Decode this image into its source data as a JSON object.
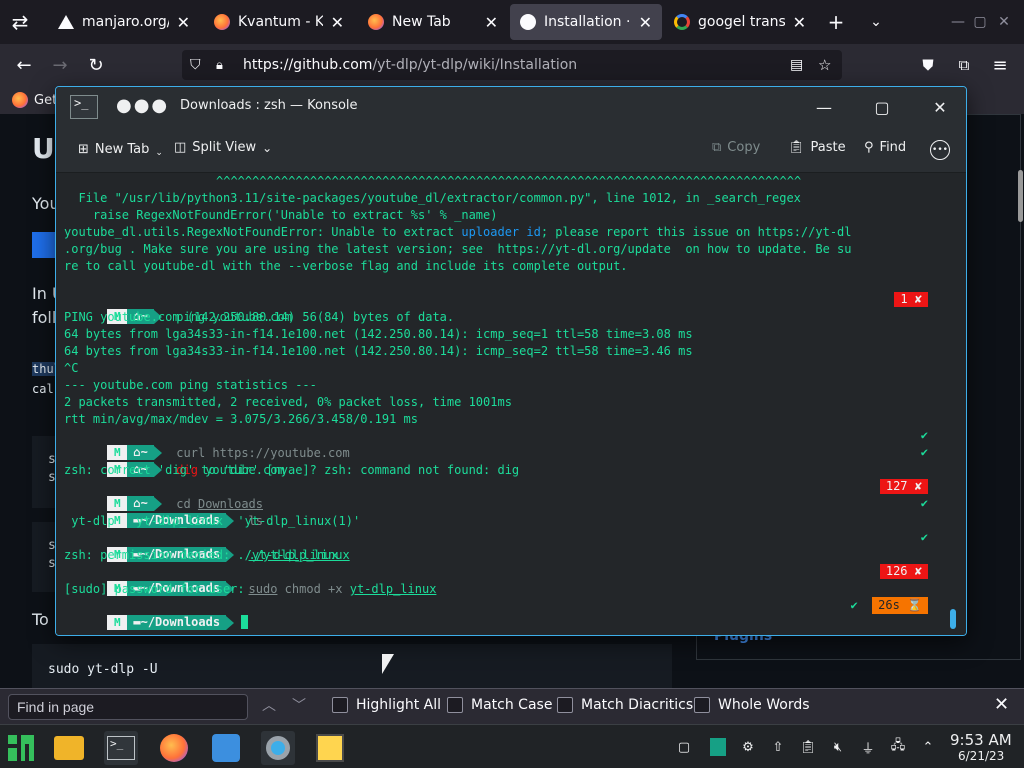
{
  "browser": {
    "tabs": [
      {
        "label": "manjaro.org/",
        "icon": "warning-icon"
      },
      {
        "label": "Kvantum - KDE",
        "icon": "firefox-icon"
      },
      {
        "label": "New Tab",
        "icon": "firefox-icon"
      },
      {
        "label": "Installation · yt",
        "icon": "github-icon",
        "active": true
      },
      {
        "label": "googel translat",
        "icon": "google-icon"
      }
    ],
    "url_host": "https://github.com",
    "url_path": "/yt-dlp/yt-dlp/wiki/Installation",
    "bookmark_label": "Get",
    "find": {
      "placeholder": "Find in page",
      "highlight_all": "Highlight All",
      "match_case": "Match Case",
      "match_diacritics": "Match Diacritics",
      "whole_words": "Whole Words"
    }
  },
  "page": {
    "heading_fragment": "U",
    "text_1": "You",
    "text_2": "In U",
    "text_3": "foll",
    "text_4": "To",
    "code_1": "thul",
    "code_2": "cal",
    "code_3": "s",
    "code_4": "s",
    "code_5": "s",
    "code_6": "s",
    "code_block": "sudo yt-dlp -U",
    "sidebar_link": "Plugins"
  },
  "konsole": {
    "title": "Downloads : zsh — Konsole",
    "toolbar": {
      "new_tab": "New Tab",
      "split_view": "Split View",
      "copy": "Copy",
      "paste": "Paste",
      "find": "Find"
    },
    "lines": {
      "carets": "^^^^^^^^^^^^^^^^^^^^^^^^^^^^^^^^^^^^^^^^^^^^^^^^^^^^^^^^^^^^^^^^^^^^^^^^^^^^^^^^^",
      "l1": "  File \"/usr/lib/python3.11/site-packages/youtube_dl/extractor/common.py\", line 1012, in _search_regex",
      "l2": "    raise RegexNotFoundError('Unable to extract %s' % _name)",
      "l3a": "youtube_dl.utils.RegexNotFoundError: Unable to extract ",
      "l3b": "uploader id",
      "l3c": "; please report this issue on https://yt-dl",
      "l4": ".org/bug . Make sure you are using the latest version; see  https://yt-dl.org/update  on how to update. Be su",
      "l5": "re to call youtube-dl with the --verbose flag and include its complete output.",
      "ping_cmd": "ping",
      "ping_arg": "youtube.com",
      "ping_status": "1",
      "p1": "PING youtube.com (142.250.80.14) 56(84) bytes of data.",
      "p2": "64 bytes from lga34s33-in-f14.1e100.net (142.250.80.14): icmp_seq=1 ttl=58 time=3.08 ms",
      "p3": "64 bytes from lga34s33-in-f14.1e100.net (142.250.80.14): icmp_seq=2 ttl=58 time=3.46 ms",
      "p4": "^C",
      "p5": "--- youtube.com ping statistics ---",
      "p6": "2 packets transmitted, 2 received, 0% packet loss, time 1001ms",
      "p7": "rtt min/avg/max/mdev = 3.075/3.266/3.458/0.191 ms",
      "curl_cmd": "curl",
      "curl_arg": "https://youtube.com",
      "dig_cmd": "dig",
      "dig_arg": "youtube.com",
      "dig_err": "zsh: correct 'dig' to 'dir' [nyae]? zsh: command not found: dig",
      "cd_cmd": "cd",
      "cd_arg": "Downloads",
      "cd_status": "127",
      "dir_downloads": "~/Downloads",
      "home_dir": "~",
      "ls_cmd": "ls",
      "ls_out": " yt-dlp   yt-dlp_linux  'yt-dlp_linux(1)'",
      "run_cmd": "./yt-dlp_linux",
      "perm_err": "zsh: permission denied: ./yt-dlp_linux",
      "sudo_cmd": "sudo",
      "chmod": "chmod",
      "chmod_arg": "+x",
      "chmod_file": "yt-dlp_linux",
      "sudo_status": "126",
      "sudo_prompt": "[sudo] password for user:",
      "timer": "26s"
    }
  },
  "taskbar": {
    "time": "9:53 AM",
    "date": "6/21/23"
  }
}
